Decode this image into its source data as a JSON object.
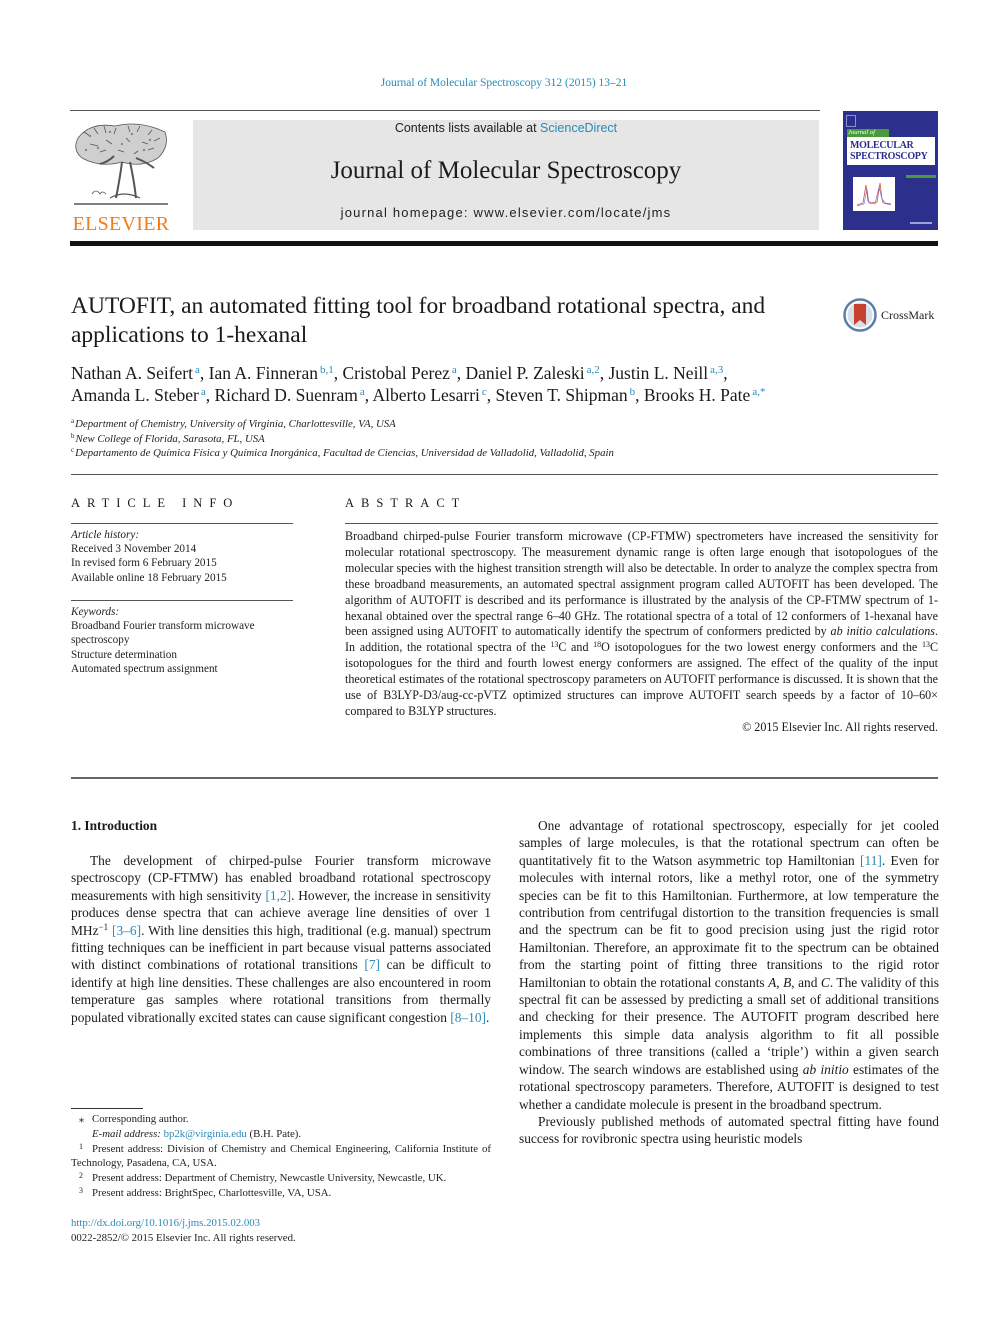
{
  "header": {
    "journal_ref": "Journal of Molecular Spectroscopy 312 (2015) 13–21",
    "contents_prefix": "Contents lists available at ",
    "sciencedirect": "ScienceDirect",
    "journal_title": "Journal of Molecular Spectroscopy",
    "homepage": "journal homepage: www.elsevier.com/locate/jms",
    "publisher": "ELSEVIER",
    "cover": {
      "journal_of": "Journal of",
      "line1": "MOLECULAR",
      "line2": "SPECTROSCOPY"
    },
    "crossmark": "CrossMark",
    "colors": {
      "link": "#2a8ab8",
      "elsevier_orange": "#f07c1a",
      "cover_blue": "#2d2f8c",
      "cover_green": "#4a9a3a",
      "masthead_gray": "#e6e6e6"
    }
  },
  "article": {
    "title": "AUTOFIT, an automated fitting tool for broadband rotational spectra, and applications to 1-hexanal",
    "authors": [
      {
        "name": "Nathan A. Seifert",
        "sup": "a"
      },
      {
        "name": "Ian A. Finneran",
        "sup": "b,1"
      },
      {
        "name": "Cristobal Perez",
        "sup": "a"
      },
      {
        "name": "Daniel P. Zaleski",
        "sup": "a,2"
      },
      {
        "name": "Justin L. Neill",
        "sup": "a,3"
      },
      {
        "name": "Amanda L. Steber",
        "sup": "a"
      },
      {
        "name": "Richard D. Suenram",
        "sup": "a"
      },
      {
        "name": "Alberto Lesarri",
        "sup": "c"
      },
      {
        "name": "Steven T. Shipman",
        "sup": "b"
      },
      {
        "name": "Brooks H. Pate",
        "sup": "a,*"
      }
    ],
    "affiliations": [
      {
        "mark": "a",
        "text": "Department of Chemistry, University of Virginia, Charlottesville, VA, USA"
      },
      {
        "mark": "b",
        "text": "New College of Florida, Sarasota, FL, USA"
      },
      {
        "mark": "c",
        "text": "Departamento de Química Física y Química Inorgánica, Facultad de Ciencias, Universidad de Valladolid, Valladolid, Spain"
      }
    ]
  },
  "article_info": {
    "heading": "ARTICLE INFO",
    "history_label": "Article history:",
    "history": [
      "Received 3 November 2014",
      "In revised form 6 February 2015",
      "Available online 18 February 2015"
    ],
    "keywords_label": "Keywords:",
    "keywords": [
      "Broadband Fourier transform microwave spectroscopy",
      "Structure determination",
      "Automated spectrum assignment"
    ]
  },
  "abstract": {
    "heading": "ABSTRACT",
    "part1": "Broadband chirped-pulse Fourier transform microwave (CP-FTMW) spectrometers have increased the sensitivity for molecular rotational spectroscopy. The measurement dynamic range is often large enough that isotopologues of the molecular species with the highest transition strength will also be detectable. In order to analyze the complex spectra from these broadband measurements, an automated spectral assignment program called AUTOFIT has been developed. The algorithm of AUTOFIT is described and its performance is illustrated by the analysis of the CP-FTMW spectrum of 1-hexanal obtained over the spectral range 6–40 GHz. The rotational spectra of a total of 12 conformers of 1-hexanal have been assigned using AUTOFIT to automatically identify the spectrum of conformers predicted by ",
    "italic1": "ab initio calculations",
    "part2": ". In addition, the rotational spectra of the ",
    "iso_13": "13",
    "part3": "C and ",
    "iso_18": "18",
    "part4": "O isotopologues for the two lowest energy conformers and the ",
    "iso_13b": "13",
    "part5": "C isotopologues for the third and fourth lowest energy conformers are assigned. The effect of the quality of the input theoretical estimates of the rotational spectroscopy parameters on AUTOFIT performance is discussed. It is shown that the use of B3LYP-D3/aug-cc-pVTZ optimized structures can improve AUTOFIT search speeds by a factor of 10–60× compared to B3LYP structures.",
    "copyright": "© 2015 Elsevier Inc. All rights reserved."
  },
  "body": {
    "section_title": "1. Introduction",
    "left_p1": {
      "t1": "The development of chirped-pulse Fourier transform microwave spectroscopy (CP-FTMW) has enabled broadband rotational spectroscopy measurements with high sensitivity ",
      "r1": "[1,2]",
      "t2": ". However, the increase in sensitivity produces dense spectra that can achieve average line densities of over 1 MHz",
      "sup1": "−1",
      "t3": " ",
      "r2": "[3–6]",
      "t4": ". With line densities this high, traditional (e.g. manual) spectrum fitting techniques can be inefficient in part because visual patterns associated with distinct combinations of rotational transitions ",
      "r3": "[7]",
      "t5": " can be difficult to identify at high line densities. These challenges are also encountered in room temperature gas samples where rotational transitions from thermally populated vibrationally excited states can cause significant congestion ",
      "r4": "[8–10]",
      "t6": "."
    },
    "right_p1": {
      "t1": "One advantage of rotational spectroscopy, especially for jet cooled samples of large molecules, is that the rotational spectrum can often be quantitatively fit to the Watson asymmetric top Hamiltonian ",
      "r1": "[11]",
      "t2": ". Even for molecules with internal rotors, like a methyl rotor, one of the symmetry species can be fit to this Hamiltonian. Furthermore, at low temperature the contribution from centrifugal distortion to the transition frequencies is small and the spectrum can be fit to good precision using just the rigid rotor Hamiltonian. Therefore, an approximate fit to the spectrum can be obtained from the starting point of fitting three transitions to the rigid rotor Hamiltonian to obtain the rotational constants ",
      "iA": "A",
      "t3": ", ",
      "iB": "B",
      "t4": ", and ",
      "iC": "C",
      "t5": ". The validity of this spectral fit can be assessed by predicting a small set of additional transitions and checking for their presence. The AUTOFIT program described here implements this simple data analysis algorithm to fit all possible combinations of three transitions (called a ‘triple’) within a given search window. The search windows are established using ",
      "i_abinitio": "ab initio",
      "t6": " estimates of the rotational spectroscopy parameters. Therefore, AUTOFIT is designed to test whether a candidate molecule is present in the broadband spectrum."
    },
    "right_p2": "Previously published methods of automated spectral fitting have found success for rovibronic spectra using heuristic models"
  },
  "footnotes": {
    "corresponding_mark": "⁎",
    "corresponding": "Corresponding author.",
    "email_label": "E-mail address: ",
    "email": "bp2k@virginia.edu",
    "email_suffix": " (B.H. Pate).",
    "notes": [
      {
        "mark": "1",
        "text": "Present address: Division of Chemistry and Chemical Engineering, California Institute of Technology, Pasadena, CA, USA."
      },
      {
        "mark": "2",
        "text": "Present address: Department of Chemistry, Newcastle University, Newcastle, UK."
      },
      {
        "mark": "3",
        "text": "Present address: BrightSpec, Charlottesville, VA, USA."
      }
    ],
    "doi": "http://dx.doi.org/10.1016/j.jms.2015.02.003",
    "issn": "0022-2852/© 2015 Elsevier Inc. All rights reserved."
  }
}
